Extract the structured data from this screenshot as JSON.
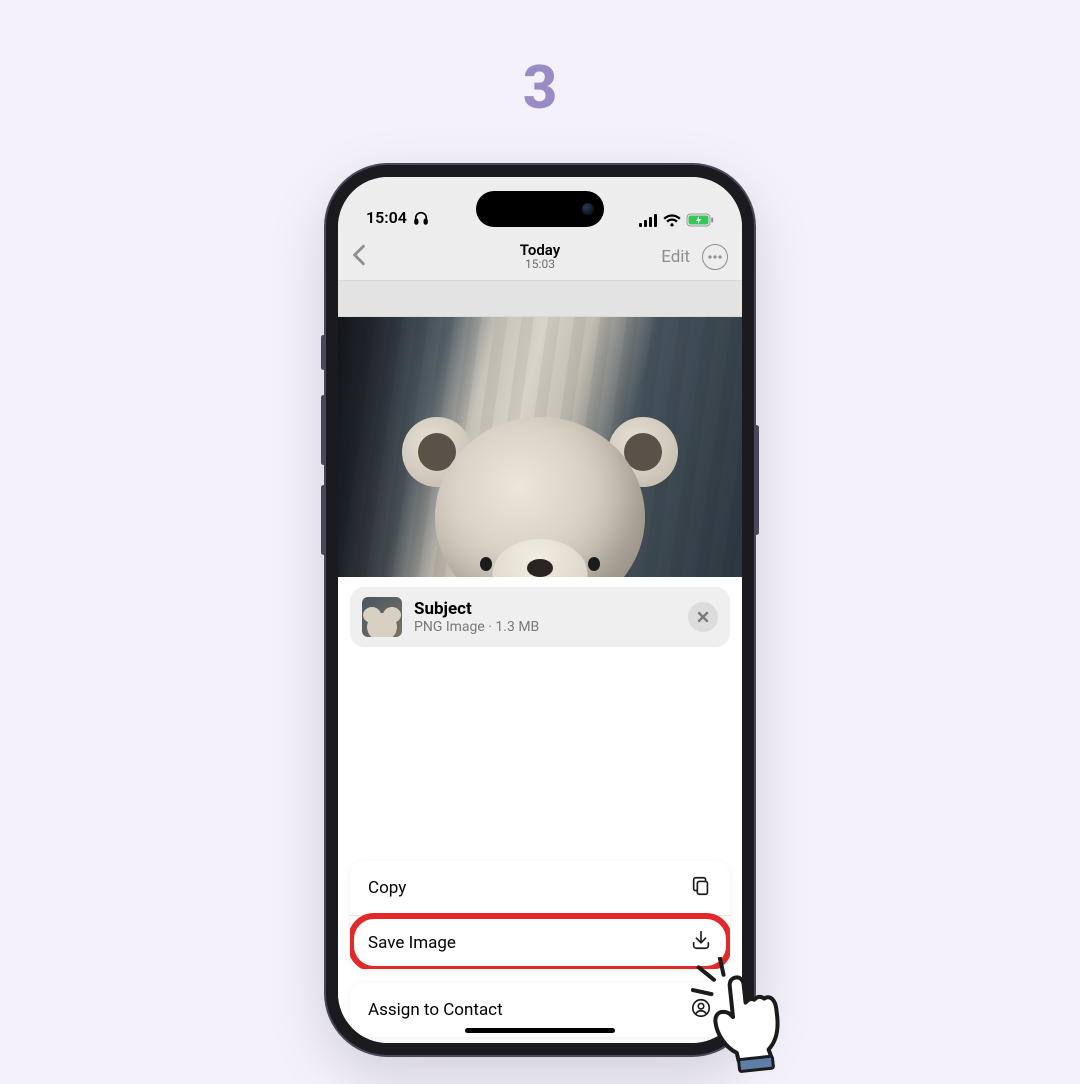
{
  "step_number": "3",
  "status_bar": {
    "time": "15:04"
  },
  "nav": {
    "title": "Today",
    "subtitle": "15:03",
    "edit_label": "Edit"
  },
  "subject_card": {
    "title": "Subject",
    "meta": "PNG Image · 1.3 MB"
  },
  "actions": {
    "copy_label": "Copy",
    "save_image_label": "Save Image",
    "assign_contact_label": "Assign to Contact"
  },
  "colors": {
    "accent_step": "#9b8bc5",
    "highlight_red": "#e22828"
  }
}
